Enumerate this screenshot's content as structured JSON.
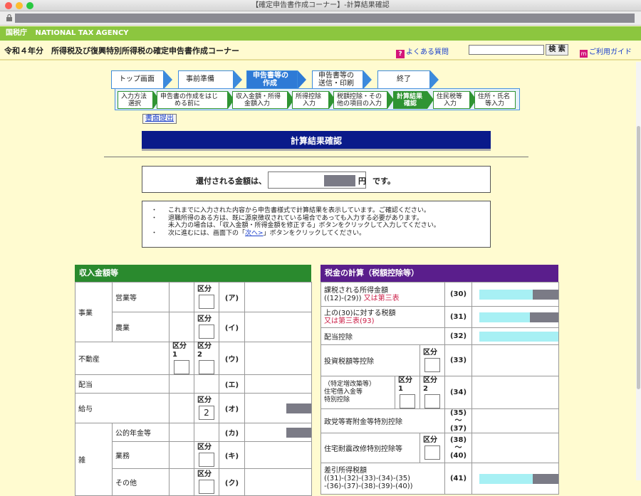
{
  "window": {
    "title": "【確定申告書作成コーナー】-計算結果確認"
  },
  "agency": {
    "name_ja": "国税庁",
    "name_en": "NATIONAL TAX AGENCY"
  },
  "header": {
    "title": "令和４年分　所得税及び復興特別所得税の確定申告書作成コーナー",
    "faq": "よくある質問",
    "search_placeholder": "",
    "search_button": "検 索",
    "help": "ご利用ガイド"
  },
  "steps": [
    {
      "label": "トップ画面"
    },
    {
      "label": "事前準備"
    },
    {
      "label": "申告書等の作成",
      "line1": "申告書等の",
      "line2": "作成"
    },
    {
      "label": "申告書等の送信・印刷",
      "line1": "申告書等の",
      "line2": "送信・印刷"
    },
    {
      "label": "終了"
    }
  ],
  "substeps": [
    {
      "line1": "入力方法",
      "line2": "選択"
    },
    {
      "line1": "申告書の作成をはじ",
      "line2": "める前に"
    },
    {
      "line1": "収入金額・所得",
      "line2": "金額入力"
    },
    {
      "line1": "所得控除",
      "line2": "入力"
    },
    {
      "line1": "税額控除・その",
      "line2": "他の項目の入力"
    },
    {
      "line1": "計算結果",
      "line2": "確認"
    },
    {
      "line1": "住民税等",
      "line2": "入力"
    },
    {
      "line1": "住所・氏名",
      "line2": "等入力"
    }
  ],
  "print_button": "書面提出",
  "page_title": "計算結果確認",
  "refund": {
    "label": "還付される金額は、",
    "unit": "円",
    "tail": "です。"
  },
  "notes": [
    "これまでに入力された内容から申告書様式で計算結果を表示しています。ご確認ください。",
    "退職所得のある方は、既に源泉徴収されている場合であっても入力する必要があります。",
    "未入力の場合は、「収入金額・所得金額を修正する」ボタンをクリックして入力してください。",
    "次に進むには、画面下の「",
    "次へ>",
    "」ボタンをクリックしてください。"
  ],
  "income": {
    "header": "収入金額等",
    "colors": {
      "header_bg": "#2a8a2e"
    },
    "rows": {
      "jigyo": "事業",
      "eigyo": "営業等",
      "eigyo_code": "(ア)",
      "nogyo": "農業",
      "nogyo_code": "(イ)",
      "fudosan": "不動産",
      "fudosan_code": "(ウ)",
      "haito": "配当",
      "haito_code": "(エ)",
      "kyuyo": "給与",
      "kyuyo_code": "(オ)",
      "kyuyo_kubun": "2",
      "zatsu": "雑",
      "nenkin": "公的年金等",
      "nenkin_code": "(カ)",
      "gyomu": "業務",
      "gyomu_code": "(キ)",
      "sonota": "その他",
      "sonota_code": "(ク)"
    },
    "kubun": "区分",
    "kubun1": "区分1",
    "kubun2": "区分2"
  },
  "tax": {
    "header": "税金の計算（税額控除等）",
    "colors": {
      "header_bg": "#5a1e8c"
    },
    "rows": [
      {
        "l1": "課税される所得金額",
        "l2": "((12)-(29))",
        "red": "又は第三表",
        "code": "(30)",
        "fill": 0.68
      },
      {
        "l1": "上の(30)に対する税額",
        "red": "又は第三表(93)",
        "code": "(31)",
        "fill": 0.64
      },
      {
        "l1": "配当控除",
        "code": "(32)",
        "fill": 1.0
      },
      {
        "l1": "投資税額等控除",
        "code": "(33)",
        "kubun": "区分"
      },
      {
        "l1": "（特定増改築等）",
        "l2": "住宅借入金等",
        "l3": "特別控除",
        "code": "(34)",
        "kubun1": "区分1",
        "kubun2": "区分2"
      },
      {
        "l1": "政党等寄附金等特別控除",
        "code": "(35)～",
        "code2": "(37)"
      },
      {
        "l1": "住宅耐震改修特別控除等",
        "code": "(38)～",
        "code2": "(40)",
        "kubun": "区分"
      },
      {
        "l1": "差引所得税額",
        "l2": "((31)-(32)-(33)-(34)-(35)",
        "l3": "-(36)-(37)-(38)-(39)-(40))",
        "code": "(41)",
        "fill": 0.68
      }
    ]
  }
}
